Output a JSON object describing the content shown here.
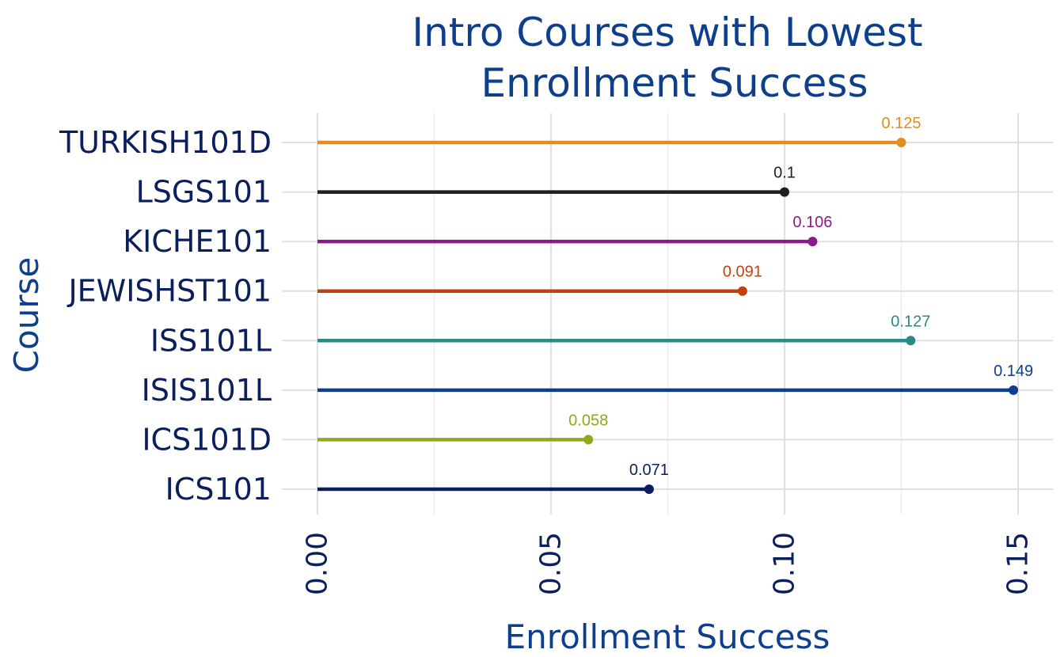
{
  "chart_data": {
    "type": "lollipop",
    "title_line1": "Intro Courses with Lowest",
    "title_line2": "Enrollment Success",
    "xlabel": "Enrollment Success",
    "ylabel": "Course",
    "xlim": [
      0,
      0.15
    ],
    "x_ticks": [
      0.0,
      0.05,
      0.1,
      0.15
    ],
    "x_tick_labels": [
      "0.00",
      "0.05",
      "0.10",
      "0.15"
    ],
    "grid": true,
    "categories": [
      "TURKISH101D",
      "LSGS101",
      "KICHE101",
      "JEWISHST101",
      "ISS101L",
      "ISIS101L",
      "ICS101D",
      "ICS101"
    ],
    "values": [
      0.125,
      0.1,
      0.106,
      0.091,
      0.127,
      0.149,
      0.058,
      0.071
    ],
    "value_labels": [
      "0.125",
      "0.1",
      "0.106",
      "0.091",
      "0.127",
      "0.149",
      "0.058",
      "0.071"
    ],
    "colors": [
      "#e08e1e",
      "#1f1f1f",
      "#8b1a8b",
      "#c4410f",
      "#2a8a86",
      "#0d3f8c",
      "#8eaa1b",
      "#0b1f5c"
    ]
  }
}
